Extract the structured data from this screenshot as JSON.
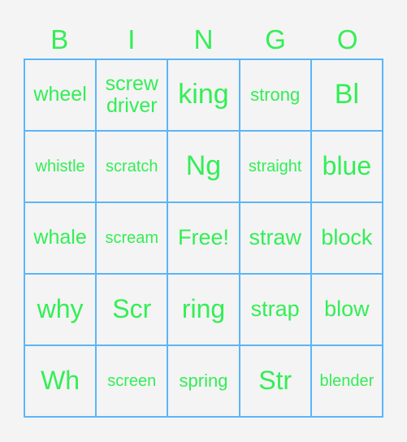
{
  "header": [
    "B",
    "I",
    "N",
    "G",
    "O"
  ],
  "cells": [
    [
      "wheel",
      "screw driver",
      "king",
      "strong",
      "Bl"
    ],
    [
      "whistle",
      "scratch",
      "Ng",
      "straight",
      "blue"
    ],
    [
      "whale",
      "scream",
      "Free!",
      "straw",
      "block"
    ],
    [
      "why",
      "Scr",
      "ring",
      "strap",
      "blow"
    ],
    [
      "Wh",
      "screen",
      "spring",
      "Str",
      "blender"
    ]
  ],
  "colors": {
    "text": "#33ee55",
    "border": "#5bb5f8",
    "background": "#f4f4f4"
  }
}
